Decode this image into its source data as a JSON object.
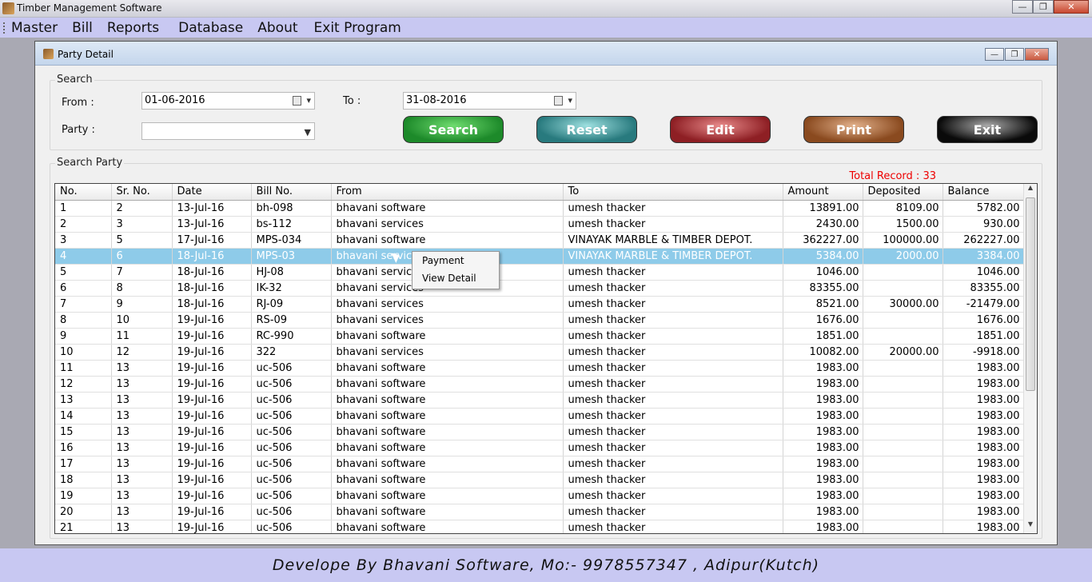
{
  "app": {
    "title": "Timber Management Software"
  },
  "menu": [
    "Master",
    "Bill",
    "Reports",
    "Database",
    "About",
    "Exit Program"
  ],
  "window": {
    "title": "Party Detail"
  },
  "search": {
    "legend": "Search",
    "from_label": "From :",
    "from_value": "01-06-2016",
    "to_label": "To :",
    "to_value": "31-08-2016",
    "party_label": "Party :",
    "party_value": ""
  },
  "buttons": {
    "search": "Search",
    "reset": "Reset",
    "edit": "Edit",
    "print": "Print",
    "exit": "Exit"
  },
  "party": {
    "legend": "Search Party",
    "total_record": "Total Record : 33"
  },
  "table": {
    "columns": [
      "No.",
      "Sr. No.",
      "Date",
      "Bill No.",
      "From",
      "To",
      "Amount",
      "Deposited",
      "Balance"
    ],
    "selected_row": 3,
    "rows": [
      [
        "1",
        "2",
        "13-Jul-16",
        "bh-098",
        "bhavani software",
        "umesh thacker",
        "13891.00",
        "8109.00",
        "5782.00"
      ],
      [
        "2",
        "3",
        "13-Jul-16",
        "bs-112",
        "bhavani services",
        "umesh thacker",
        "2430.00",
        "1500.00",
        "930.00"
      ],
      [
        "3",
        "5",
        "17-Jul-16",
        "MPS-034",
        "bhavani software",
        "VINAYAK MARBLE & TIMBER DEPOT.",
        "362227.00",
        "100000.00",
        "262227.00"
      ],
      [
        "4",
        "6",
        "18-Jul-16",
        "MPS-03",
        "bhavani services",
        "VINAYAK MARBLE & TIMBER DEPOT.",
        "5384.00",
        "2000.00",
        "3384.00"
      ],
      [
        "5",
        "7",
        "18-Jul-16",
        "HJ-08",
        "bhavani services",
        "umesh thacker",
        "1046.00",
        "",
        "1046.00"
      ],
      [
        "6",
        "8",
        "18-Jul-16",
        "IK-32",
        "bhavani services",
        "umesh thacker",
        "83355.00",
        "",
        "83355.00"
      ],
      [
        "7",
        "9",
        "18-Jul-16",
        "RJ-09",
        "bhavani services",
        "umesh thacker",
        "8521.00",
        "30000.00",
        "-21479.00"
      ],
      [
        "8",
        "10",
        "19-Jul-16",
        "RS-09",
        "bhavani services",
        "umesh thacker",
        "1676.00",
        "",
        "1676.00"
      ],
      [
        "9",
        "11",
        "19-Jul-16",
        "RC-990",
        "bhavani software",
        "umesh thacker",
        "1851.00",
        "",
        "1851.00"
      ],
      [
        "10",
        "12",
        "19-Jul-16",
        "322",
        "bhavani services",
        "umesh thacker",
        "10082.00",
        "20000.00",
        "-9918.00"
      ],
      [
        "11",
        "13",
        "19-Jul-16",
        "uc-506",
        "bhavani software",
        "umesh thacker",
        "1983.00",
        "",
        "1983.00"
      ],
      [
        "12",
        "13",
        "19-Jul-16",
        "uc-506",
        "bhavani software",
        "umesh thacker",
        "1983.00",
        "",
        "1983.00"
      ],
      [
        "13",
        "13",
        "19-Jul-16",
        "uc-506",
        "bhavani software",
        "umesh thacker",
        "1983.00",
        "",
        "1983.00"
      ],
      [
        "14",
        "13",
        "19-Jul-16",
        "uc-506",
        "bhavani software",
        "umesh thacker",
        "1983.00",
        "",
        "1983.00"
      ],
      [
        "15",
        "13",
        "19-Jul-16",
        "uc-506",
        "bhavani software",
        "umesh thacker",
        "1983.00",
        "",
        "1983.00"
      ],
      [
        "16",
        "13",
        "19-Jul-16",
        "uc-506",
        "bhavani software",
        "umesh thacker",
        "1983.00",
        "",
        "1983.00"
      ],
      [
        "17",
        "13",
        "19-Jul-16",
        "uc-506",
        "bhavani software",
        "umesh thacker",
        "1983.00",
        "",
        "1983.00"
      ],
      [
        "18",
        "13",
        "19-Jul-16",
        "uc-506",
        "bhavani software",
        "umesh thacker",
        "1983.00",
        "",
        "1983.00"
      ],
      [
        "19",
        "13",
        "19-Jul-16",
        "uc-506",
        "bhavani software",
        "umesh thacker",
        "1983.00",
        "",
        "1983.00"
      ],
      [
        "20",
        "13",
        "19-Jul-16",
        "uc-506",
        "bhavani software",
        "umesh thacker",
        "1983.00",
        "",
        "1983.00"
      ],
      [
        "21",
        "13",
        "19-Jul-16",
        "uc-506",
        "bhavani software",
        "umesh thacker",
        "1983.00",
        "",
        "1983.00"
      ]
    ]
  },
  "context_menu": [
    "Payment",
    "View Detail"
  ],
  "footer": {
    "text": "Develope By Bhavani Software, Mo:- 9978557347 , Adipur(Kutch)"
  }
}
